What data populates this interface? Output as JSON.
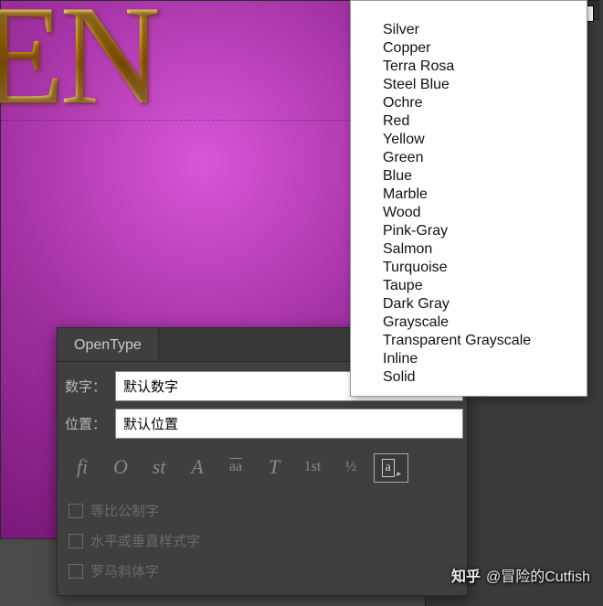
{
  "canvas": {
    "text": "TEN"
  },
  "dropdown": {
    "items": [
      "Silver",
      "Copper",
      "Terra Rosa",
      "Steel Blue",
      "Ochre",
      "Red",
      "Yellow",
      "Green",
      "Blue",
      "Marble",
      "Wood",
      "Pink-Gray",
      "Salmon",
      "Turquoise",
      "Taupe",
      "Dark Gray",
      "Grayscale",
      "Transparent Grayscale",
      "Inline",
      "Solid"
    ]
  },
  "opentype": {
    "tab_label": "OpenType",
    "rows": {
      "digits_label": "数字：",
      "digits_value": "默认数字",
      "position_label": "位置：",
      "position_value": "默认位置"
    },
    "icons": [
      "fi",
      "O",
      "st",
      "A",
      "aa",
      "T",
      "1st",
      "½",
      "a"
    ],
    "checks": {
      "proportional": "等比公制字",
      "horizontal_vertical": "水平或垂直样式字",
      "roman_italic": "罗马斜体字"
    }
  },
  "watermark": {
    "logo": "知乎",
    "handle": "@冒险的Cutfish"
  }
}
